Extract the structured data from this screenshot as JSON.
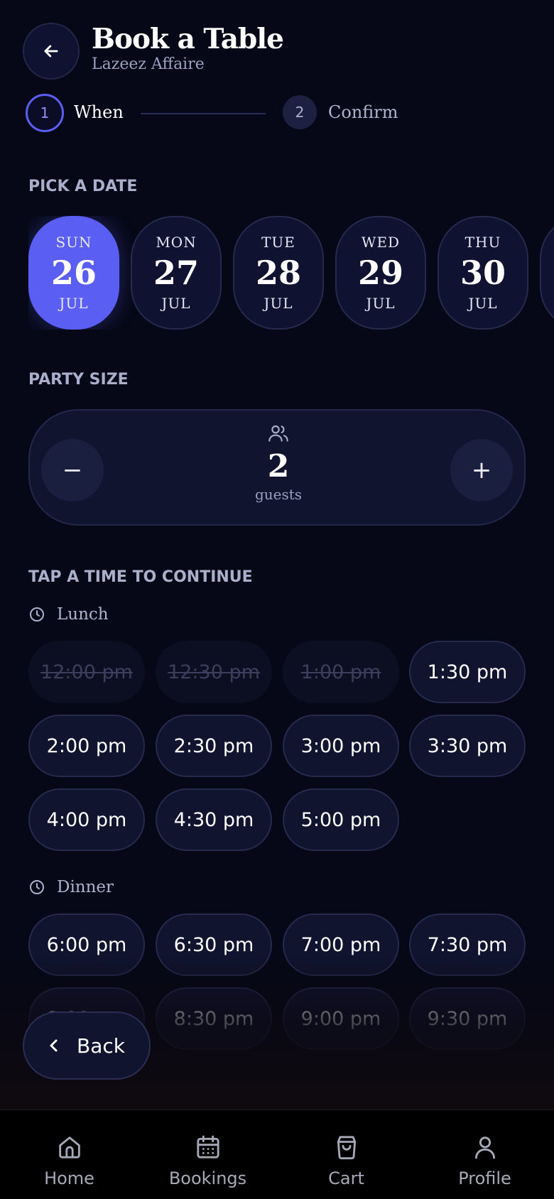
{
  "header": {
    "title": "Book a Table",
    "subtitle": "Lazeez Affaire"
  },
  "stepper": {
    "steps": [
      {
        "number": "1",
        "label": "When"
      },
      {
        "number": "2",
        "label": "Confirm"
      }
    ]
  },
  "date_section": {
    "label": "PICK A DATE",
    "dates": [
      {
        "dow": "SUN",
        "day": "26",
        "month": "JUL"
      },
      {
        "dow": "MON",
        "day": "27",
        "month": "JUL"
      },
      {
        "dow": "TUE",
        "day": "28",
        "month": "JUL"
      },
      {
        "dow": "WED",
        "day": "29",
        "month": "JUL"
      },
      {
        "dow": "THU",
        "day": "30",
        "month": "JUL"
      }
    ]
  },
  "party": {
    "label": "PARTY SIZE",
    "count": "2",
    "unit": "guests",
    "minus": "−",
    "plus": "+"
  },
  "times": {
    "label": "TAP A TIME TO CONTINUE",
    "lunch": {
      "label": "Lunch",
      "slots": [
        "12:00 pm",
        "12:30 pm",
        "1:00 pm",
        "1:30 pm",
        "2:00 pm",
        "2:30 pm",
        "3:00 pm",
        "3:30 pm",
        "4:00 pm",
        "4:30 pm",
        "5:00 pm"
      ]
    },
    "dinner": {
      "label": "Dinner",
      "slots": [
        "6:00 pm",
        "6:30 pm",
        "7:00 pm",
        "7:30 pm",
        "8:00 pm",
        "8:30 pm",
        "9:00 pm",
        "9:30 pm"
      ]
    }
  },
  "back_button": {
    "label": "Back"
  },
  "nav": {
    "items": [
      {
        "label": "Home",
        "icon": "home-icon"
      },
      {
        "label": "Bookings",
        "icon": "calendar-icon"
      },
      {
        "label": "Cart",
        "icon": "bag-icon"
      },
      {
        "label": "Profile",
        "icon": "user-icon"
      }
    ]
  },
  "colors": {
    "accent": "#5b5ef2",
    "background": "#060817",
    "card": "#11142f"
  }
}
